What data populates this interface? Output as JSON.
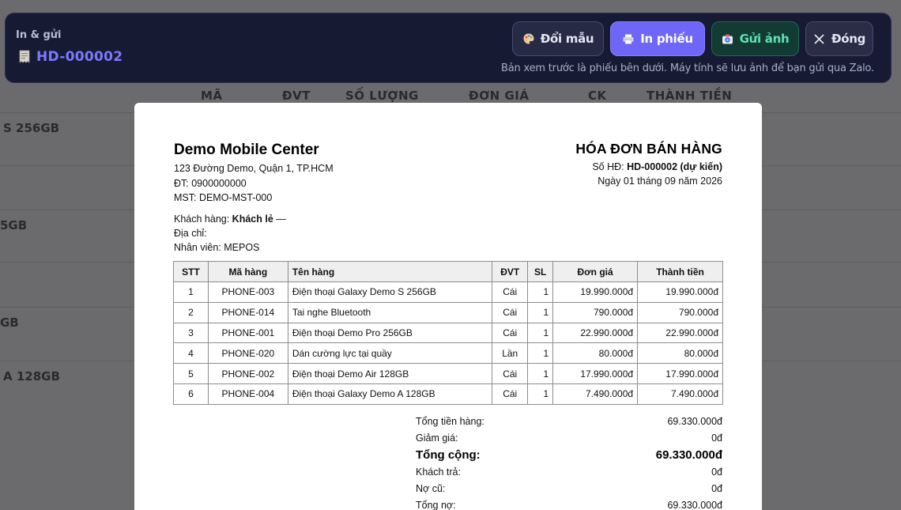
{
  "background": {
    "headers": [
      "MÃ",
      "ĐVT",
      "SỐ LƯỢNG",
      "ĐƠN GIÁ",
      "CK",
      "THÀNH TIỀN"
    ],
    "row_fragments": [
      "S 256GB",
      "",
      "5GB",
      "",
      "GB",
      "A 128GB"
    ]
  },
  "topbar": {
    "title": "In & gửi",
    "code": "HD-000002",
    "buttons": {
      "change_color": "Đổi mẫu",
      "print": "In phiếu",
      "send_image": "Gửi ảnh",
      "close": "Đóng"
    },
    "hint": "Bản xem trước là phiếu bên dưới. Máy tính sẽ lưu ảnh để bạn gửi qua Zalo."
  },
  "invoice": {
    "store": {
      "name": "Demo Mobile Center",
      "address": "123 Đường Demo, Quận 1, TP.HCM",
      "phone": "ĐT: 0900000000",
      "tax": "MST: DEMO-MST-000"
    },
    "title": "HÓA ĐƠN BÁN HÀNG",
    "number_label": "Số HĐ: ",
    "number_value": "HD-000002 (dự kiến)",
    "date": "Ngày 01 tháng 09 năm 2026",
    "customer_label": "Khách hàng: ",
    "customer_value": "Khách lẻ",
    "customer_suffix": " —",
    "address_label": "Địa chỉ:",
    "staff": "Nhân viên: MEPOS",
    "columns": [
      "STT",
      "Mã hàng",
      "Tên hàng",
      "ĐVT",
      "SL",
      "Đơn giá",
      "Thành tiền"
    ],
    "items": [
      {
        "stt": "1",
        "code": "PHONE-003",
        "name": "Điện thoại Galaxy Demo S 256GB",
        "unit": "Cái",
        "qty": "1",
        "price": "19.990.000đ",
        "total": "19.990.000đ"
      },
      {
        "stt": "2",
        "code": "PHONE-014",
        "name": "Tai nghe Bluetooth",
        "unit": "Cái",
        "qty": "1",
        "price": "790.000đ",
        "total": "790.000đ"
      },
      {
        "stt": "3",
        "code": "PHONE-001",
        "name": "Điện thoại Demo Pro 256GB",
        "unit": "Cái",
        "qty": "1",
        "price": "22.990.000đ",
        "total": "22.990.000đ"
      },
      {
        "stt": "4",
        "code": "PHONE-020",
        "name": "Dán cường lực tại quầy",
        "unit": "Lần",
        "qty": "1",
        "price": "80.000đ",
        "total": "80.000đ"
      },
      {
        "stt": "5",
        "code": "PHONE-002",
        "name": "Điện thoại Demo Air 128GB",
        "unit": "Cái",
        "qty": "1",
        "price": "17.990.000đ",
        "total": "17.990.000đ"
      },
      {
        "stt": "6",
        "code": "PHONE-004",
        "name": "Điện thoại Galaxy Demo A 128GB",
        "unit": "Cái",
        "qty": "1",
        "price": "7.490.000đ",
        "total": "7.490.000đ"
      }
    ],
    "totals": [
      {
        "label": "Tổng tiền hàng:",
        "value": "69.330.000đ",
        "grand": false
      },
      {
        "label": "Giảm giá:",
        "value": "0đ",
        "grand": false
      },
      {
        "label": "Tổng cộng:",
        "value": "69.330.000đ",
        "grand": true
      },
      {
        "label": "Khách trả:",
        "value": "0đ",
        "grand": false
      },
      {
        "label": "Nợ cũ:",
        "value": "0đ",
        "grand": false
      },
      {
        "label": "Tổng nợ:",
        "value": "69.330.000đ",
        "grand": false
      }
    ]
  }
}
